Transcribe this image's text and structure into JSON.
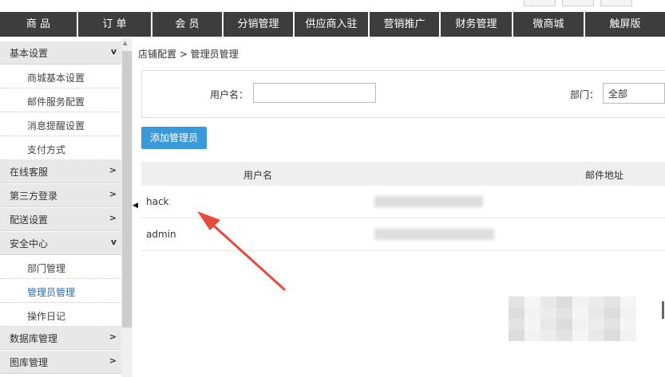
{
  "nav": {
    "items": [
      "商 品",
      "订 单",
      "会 员",
      "分销管理",
      "供应商入驻",
      "营销推广",
      "财务管理",
      "微商城",
      "触屏版"
    ]
  },
  "sidebar": {
    "groups": [
      {
        "label": "基本设置",
        "arrow": "v"
      },
      {
        "label": "在线客服",
        "arrow": ">"
      },
      {
        "label": "第三方登录",
        "arrow": ">"
      },
      {
        "label": "配送设置",
        "arrow": ">"
      },
      {
        "label": "安全中心",
        "arrow": "v"
      },
      {
        "label": "数据库管理",
        "arrow": ">"
      },
      {
        "label": "图库管理",
        "arrow": ">"
      }
    ],
    "basic_items": [
      "商城基本设置",
      "邮件服务配置",
      "消息提醒设置",
      "支付方式"
    ],
    "security_items": [
      "部门管理",
      "管理员管理",
      "操作日记"
    ]
  },
  "breadcrumb": "店铺配置 > 管理员管理",
  "filter": {
    "username_label": "用户名：",
    "username_value": "",
    "dept_label": "部门：",
    "dept_value": "全部"
  },
  "add_button": "添加管理员",
  "table": {
    "headers": [
      "用户名",
      "邮件地址"
    ],
    "rows": [
      {
        "username": "hack"
      },
      {
        "username": "admin"
      }
    ]
  },
  "colors": {
    "nav_bg": "#3d3d3d",
    "accent": "#3a9ad9",
    "annotation_arrow": "#e84a3c"
  }
}
